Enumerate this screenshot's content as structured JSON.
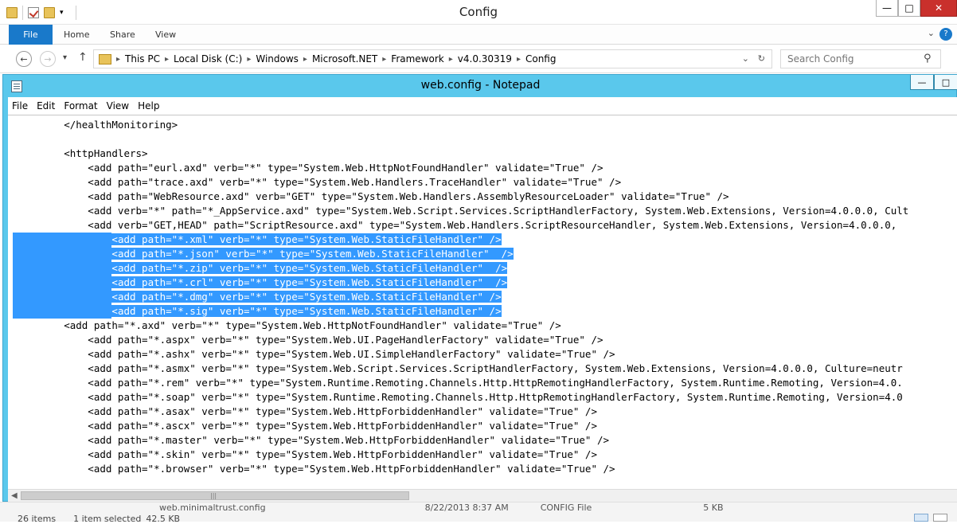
{
  "explorer": {
    "title": "Config",
    "ribbon_tabs": [
      "File",
      "Home",
      "Share",
      "View"
    ],
    "breadcrumb": [
      "This PC",
      "Local Disk (C:)",
      "Windows",
      "Microsoft.NET",
      "Framework",
      "v4.0.30319",
      "Config"
    ],
    "search_placeholder": "Search Config",
    "file_row": {
      "name": "web.minimaltrust.config",
      "date": "8/22/2013 8:37 AM",
      "type": "CONFIG File",
      "size": "5 KB"
    },
    "status": {
      "items": "26 items",
      "selected": "1 item selected",
      "size": "42.5 KB"
    }
  },
  "notepad": {
    "title": "web.config - Notepad",
    "menu": [
      "File",
      "Edit",
      "Format",
      "View",
      "Help"
    ],
    "lines": [
      "        </healthMonitoring>",
      "",
      "        <httpHandlers>",
      "            <add path=\"eurl.axd\" verb=\"*\" type=\"System.Web.HttpNotFoundHandler\" validate=\"True\" />",
      "            <add path=\"trace.axd\" verb=\"*\" type=\"System.Web.Handlers.TraceHandler\" validate=\"True\" />",
      "            <add path=\"WebResource.axd\" verb=\"GET\" type=\"System.Web.Handlers.AssemblyResourceLoader\" validate=\"True\" />",
      "            <add verb=\"*\" path=\"*_AppService.axd\" type=\"System.Web.Script.Services.ScriptHandlerFactory, System.Web.Extensions, Version=4.0.0.0, Cult",
      "            <add verb=\"GET,HEAD\" path=\"ScriptResource.axd\" type=\"System.Web.Handlers.ScriptResourceHandler, System.Web.Extensions, Version=4.0.0.0,",
      "                <add path=\"*.xml\" verb=\"*\" type=\"System.Web.StaticFileHandler\" />",
      "                <add path=\"*.json\" verb=\"*\" type=\"System.Web.StaticFileHandler\"  />",
      "                <add path=\"*.zip\" verb=\"*\" type=\"System.Web.StaticFileHandler\"  />",
      "                <add path=\"*.crl\" verb=\"*\" type=\"System.Web.StaticFileHandler\"  />",
      "                <add path=\"*.dmg\" verb=\"*\" type=\"System.Web.StaticFileHandler\" />",
      "                <add path=\"*.sig\" verb=\"*\" type=\"System.Web.StaticFileHandler\" />",
      "        <add path=\"*.axd\" verb=\"*\" type=\"System.Web.HttpNotFoundHandler\" validate=\"True\" />",
      "            <add path=\"*.aspx\" verb=\"*\" type=\"System.Web.UI.PageHandlerFactory\" validate=\"True\" />",
      "            <add path=\"*.ashx\" verb=\"*\" type=\"System.Web.UI.SimpleHandlerFactory\" validate=\"True\" />",
      "            <add path=\"*.asmx\" verb=\"*\" type=\"System.Web.Script.Services.ScriptHandlerFactory, System.Web.Extensions, Version=4.0.0.0, Culture=neutr",
      "            <add path=\"*.rem\" verb=\"*\" type=\"System.Runtime.Remoting.Channels.Http.HttpRemotingHandlerFactory, System.Runtime.Remoting, Version=4.0.",
      "            <add path=\"*.soap\" verb=\"*\" type=\"System.Runtime.Remoting.Channels.Http.HttpRemotingHandlerFactory, System.Runtime.Remoting, Version=4.0",
      "            <add path=\"*.asax\" verb=\"*\" type=\"System.Web.HttpForbiddenHandler\" validate=\"True\" />",
      "            <add path=\"*.ascx\" verb=\"*\" type=\"System.Web.HttpForbiddenHandler\" validate=\"True\" />",
      "            <add path=\"*.master\" verb=\"*\" type=\"System.Web.HttpForbiddenHandler\" validate=\"True\" />",
      "            <add path=\"*.skin\" verb=\"*\" type=\"System.Web.HttpForbiddenHandler\" validate=\"True\" />",
      "            <add path=\"*.browser\" verb=\"*\" type=\"System.Web.HttpForbiddenHandler\" validate=\"True\" />"
    ],
    "selected_line_range": [
      8,
      13
    ],
    "colors": {
      "titlebar": "#5ac8ec",
      "selection": "#3399ff"
    }
  }
}
